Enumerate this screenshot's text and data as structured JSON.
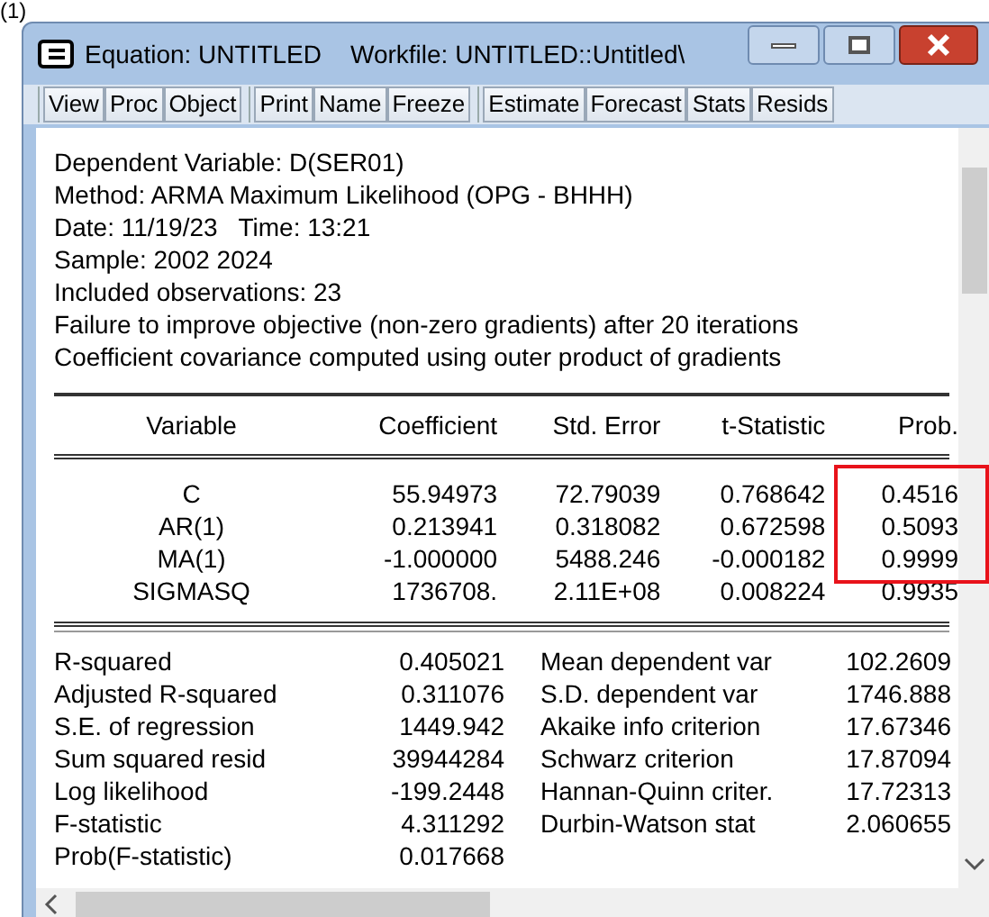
{
  "caption": "(1)",
  "window": {
    "title": "Equation: UNTITLED",
    "workfile": "Workfile: UNTITLED::Untitled\\"
  },
  "toolbar": [
    [
      "View",
      "Proc",
      "Object"
    ],
    [
      "Print",
      "Name",
      "Freeze"
    ],
    [
      "Estimate",
      "Forecast",
      "Stats",
      "Resids"
    ]
  ],
  "header_lines": [
    "Dependent Variable: D(SER01)",
    "Method: ARMA Maximum Likelihood (OPG - BHHH)",
    "Date: 11/19/23   Time: 13:21",
    "Sample: 2002 2024",
    "Included observations: 23",
    "Failure to improve objective (non-zero gradients) after 20 iterations",
    "Coefficient covariance computed using outer product of gradients"
  ],
  "table": {
    "columns": [
      "Variable",
      "Coefficient",
      "Std. Error",
      "t-Statistic",
      "Prob."
    ],
    "rows": [
      [
        "C",
        "55.94973",
        "72.79039",
        "0.768642",
        "0.4516"
      ],
      [
        "AR(1)",
        "0.213941",
        "0.318082",
        "0.672598",
        "0.5093"
      ],
      [
        "MA(1)",
        "-1.000000",
        "5488.246",
        "-0.000182",
        "0.9999"
      ],
      [
        "SIGMASQ",
        "1736708.",
        "2.11E+08",
        "0.008224",
        "0.9935"
      ]
    ]
  },
  "stats": [
    [
      "R-squared",
      "0.405021",
      "Mean dependent var",
      "102.2609"
    ],
    [
      "Adjusted R-squared",
      "0.311076",
      "S.D. dependent var",
      "1746.888"
    ],
    [
      "S.E. of regression",
      "1449.942",
      "Akaike info criterion",
      "17.67346"
    ],
    [
      "Sum squared resid",
      "39944284",
      "Schwarz criterion",
      "17.87094"
    ],
    [
      "Log likelihood",
      "-199.2448",
      "Hannan-Quinn criter.",
      "17.72313"
    ],
    [
      "F-statistic",
      "4.311292",
      "Durbin-Watson stat",
      "2.060655"
    ],
    [
      "Prob(F-statistic)",
      "0.017668"
    ]
  ],
  "highlight": {
    "on": true
  }
}
